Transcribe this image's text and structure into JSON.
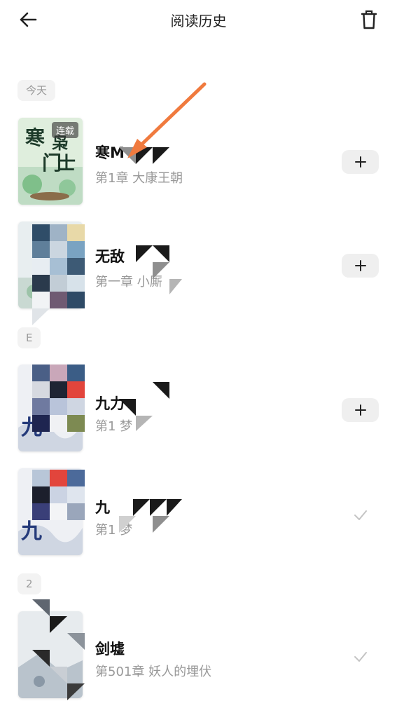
{
  "header": {
    "title": "阅读历史",
    "back_icon": "arrow-left-icon",
    "delete_icon": "trash-icon"
  },
  "sections": [
    {
      "label": "今天"
    },
    {
      "label": "E"
    },
    {
      "label": "2"
    }
  ],
  "books": [
    {
      "title": "寒M",
      "subtitle": "第1章  大康王朝",
      "badge": "连载",
      "action": "add",
      "cover_text": "寒门枭士"
    },
    {
      "title": "无敌",
      "subtitle": "第一章        小厮",
      "action": "add"
    },
    {
      "title": "九力",
      "subtitle": "第1           梦",
      "action": "add"
    },
    {
      "title": "九",
      "subtitle": "第1           梦",
      "action": "added"
    },
    {
      "title": "剑墟",
      "subtitle": "第501章    妖人的埋伏",
      "action": "added"
    }
  ],
  "colors": {
    "accent_arrow": "#f07a3e",
    "button_bg": "#efefef",
    "subtitle": "#999999"
  }
}
